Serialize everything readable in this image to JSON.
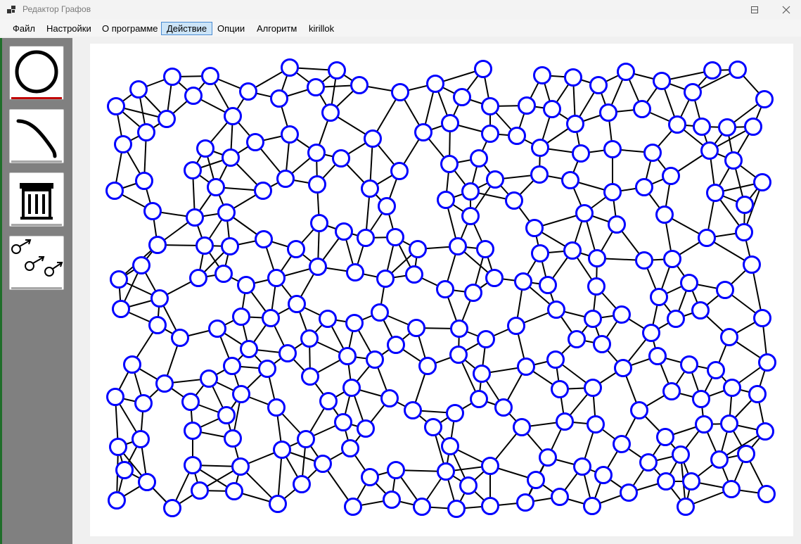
{
  "window": {
    "title": "Редактор Графов"
  },
  "menu": {
    "items": [
      {
        "id": "file",
        "label": "Файл",
        "active": false
      },
      {
        "id": "settings",
        "label": "Настройки",
        "active": false
      },
      {
        "id": "about",
        "label": "О программе",
        "active": false
      },
      {
        "id": "action",
        "label": "Действие",
        "active": true
      },
      {
        "id": "options",
        "label": "Опции",
        "active": false
      },
      {
        "id": "algorithm",
        "label": "Алгоритм",
        "active": false
      },
      {
        "id": "user",
        "label": "kirillok",
        "active": false
      }
    ]
  },
  "toolbar": {
    "tools": [
      {
        "id": "vertex",
        "icon": "circle-vertex-icon",
        "selected": true
      },
      {
        "id": "edge",
        "icon": "curve-edge-icon",
        "selected": false
      },
      {
        "id": "delete",
        "icon": "trash-icon",
        "selected": false
      },
      {
        "id": "move",
        "icon": "move-nodes-icon",
        "selected": false
      }
    ]
  },
  "colors": {
    "node_stroke": "#0000ff",
    "node_fill": "#ffffff",
    "edge": "#000000",
    "selected_tool_underline": "#c00000",
    "toolbar_bg": "#808080",
    "active_menu_bg": "#cce4f7"
  }
}
